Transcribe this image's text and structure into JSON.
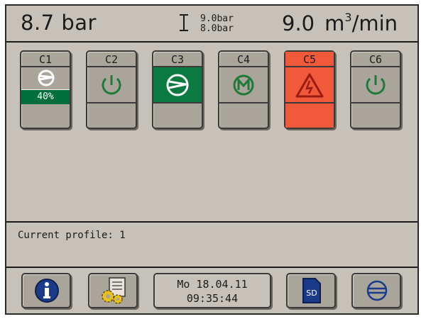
{
  "header": {
    "pressure": "8.7 bar",
    "range_high": "9.0bar",
    "range_low": "8.0bar",
    "flow_value": "9.0",
    "flow_unit_base": "m",
    "flow_unit_sup": "3",
    "flow_unit_suffix": "/min"
  },
  "compressors": [
    {
      "label": "C1",
      "state": "load",
      "icon": "compressor-icon",
      "percent": "40%"
    },
    {
      "label": "C2",
      "state": "standby",
      "icon": "power-icon"
    },
    {
      "label": "C3",
      "state": "running",
      "icon": "compressor-icon"
    },
    {
      "label": "C4",
      "state": "maintenance",
      "icon": "maintenance-m-icon"
    },
    {
      "label": "C5",
      "state": "alarm",
      "icon": "warning-icon"
    },
    {
      "label": "C6",
      "state": "standby",
      "icon": "power-icon"
    }
  ],
  "profile": {
    "text": "Current profile: 1"
  },
  "footer": {
    "date": "Mo 18.04.11",
    "time": "09:35:44",
    "sd_label": "SD",
    "info_icon": "info-icon",
    "settings_icon": "settings-gears-icon",
    "network_icon": "network-circle-icon"
  },
  "colors": {
    "screen_bg": "#c7c2b9",
    "button_bg": "#aaa59b",
    "running_green": "#0a7a42",
    "icon_green": "#1f7a3a",
    "alarm_red": "#f05a3a",
    "info_blue": "#1b3b8a"
  }
}
